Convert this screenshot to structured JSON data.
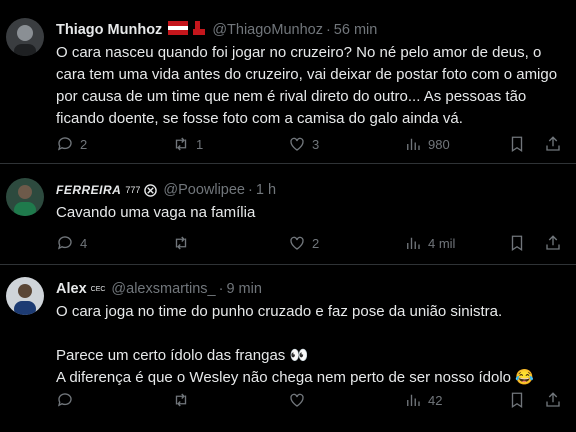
{
  "tweets": [
    {
      "name": "Thiago Munhoz",
      "handle": "@ThiagoMunhoz",
      "time": "56 min",
      "text": "O cara nasceu quando foi jogar no cruzeiro? No né pelo amor de deus, o cara tem uma vida antes do cruzeiro, vai deixar de postar foto com o amigo por causa de um time que nem é rival direto do outro... As pessoas tão ficando doente, se fosse foto com a camisa do galo ainda vá.",
      "replies": "2",
      "retweets": "1",
      "likes": "3",
      "views": "980"
    },
    {
      "name": "FERREIRA",
      "name_badge": "777",
      "handle": "@Poowlipee",
      "time": "1 h",
      "text": "Cavando uma vaga na família",
      "replies": "4",
      "retweets": "",
      "likes": "2",
      "views": "4 mil"
    },
    {
      "name": "Alex",
      "name_badge": "CEC",
      "handle": "@alexsmartins_",
      "time": "9 min",
      "text_lines": [
        "O cara joga no time do punho cruzado e faz pose da união sinistra.",
        "",
        "Parece um certo ídolo das frangas 👀",
        "A diferença é que o Wesley não chega nem perto de ser nosso ídolo 😂"
      ],
      "replies": "",
      "retweets": "",
      "likes": "",
      "views": "42"
    }
  ],
  "icons": {
    "reply": "reply-icon",
    "retweet": "retweet-icon",
    "like": "heart-icon",
    "views": "views-icon",
    "bookmark": "bookmark-icon",
    "share": "share-icon"
  },
  "colors": {
    "background": "#000000",
    "text": "#e7e9ea",
    "muted": "#71767b",
    "divider": "#2f3336"
  }
}
